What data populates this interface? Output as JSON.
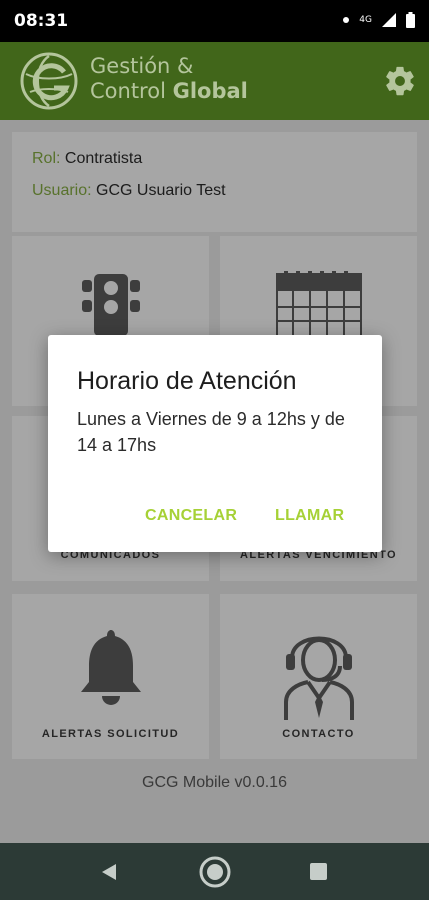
{
  "status_bar": {
    "time": "08:31",
    "network": "4G"
  },
  "header": {
    "brand_line1": "Gestión &",
    "brand_line2_a": "Control ",
    "brand_line2_b": "Global",
    "icons": {
      "logo": "gcg-globe-logo",
      "settings": "gear-icon"
    }
  },
  "user_info": {
    "role_label": "Rol:",
    "role_value": "Contratista",
    "user_label": "Usuario:",
    "user_value": "GCG Usuario Test"
  },
  "tiles": [
    {
      "label": "",
      "icon": "traffic-light-icon"
    },
    {
      "label": "",
      "icon": "calendar-icon"
    },
    {
      "label": "COMUNICADOS",
      "icon": ""
    },
    {
      "label": "ALERTAS VENCIMIENTO",
      "icon": ""
    },
    {
      "label": "ALERTAS SOLICITUD",
      "icon": "bell-icon"
    },
    {
      "label": "CONTACTO",
      "icon": "support-agent-icon"
    }
  ],
  "version": "GCG Mobile v0.0.16",
  "dialog": {
    "title": "Horario de Atención",
    "message": "Lunes a Viernes de 9 a 12hs y de 14 a 17hs",
    "cancel": "CANCELAR",
    "call": "LLAMAR"
  },
  "nav": {
    "icons": [
      "back-icon",
      "home-icon",
      "recents-icon"
    ]
  },
  "colors": {
    "header": "#41661a",
    "accent": "#a6d136",
    "label_green": "#58722c",
    "nav": "#2c3a36"
  }
}
